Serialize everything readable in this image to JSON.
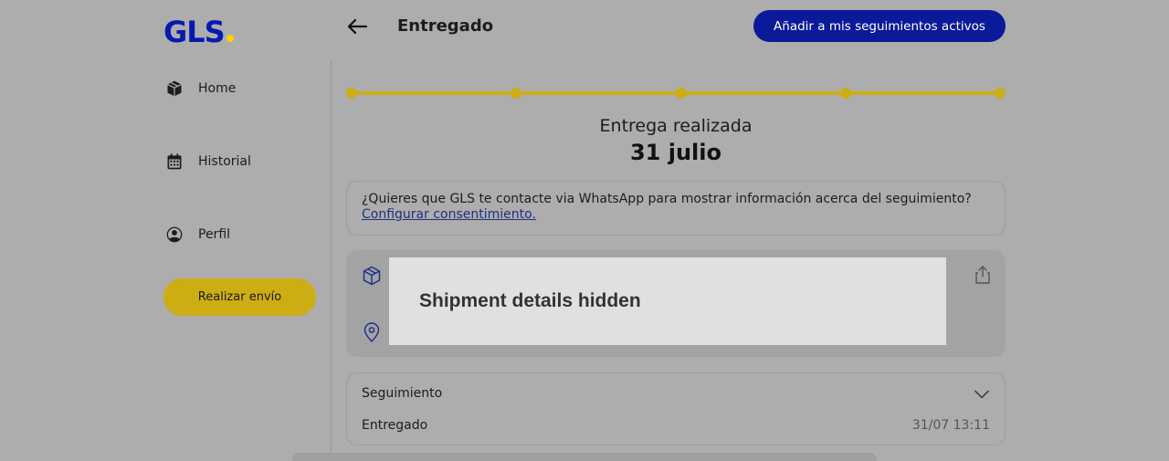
{
  "brand": {
    "logo_text": "GLS",
    "logo_color": "#061ab1",
    "accent_color": "#ffd100"
  },
  "sidebar": {
    "items": [
      {
        "label": "Home",
        "icon": "package-icon"
      },
      {
        "label": "Historial",
        "icon": "calendar-icon"
      },
      {
        "label": "Perfil",
        "icon": "user-icon"
      }
    ],
    "cta_label": "Realizar envío"
  },
  "header": {
    "title": "Entregado",
    "add_button_label": "Añadir a mis seguimientos activos"
  },
  "progress": {
    "steps_total": 5,
    "steps_completed": 5
  },
  "status": {
    "label": "Entrega realizada",
    "date": "31 julio"
  },
  "whatsapp": {
    "question": "¿Quieres que GLS te contacte via WhatsApp para mostrar información acerca del seguimiento?",
    "link_label": "Configurar consentimiento."
  },
  "shipment": {
    "hidden_notice": "Shipment details hidden"
  },
  "tracking": {
    "title": "Seguimiento",
    "event": "Entregado",
    "timestamp": "31/07 13:11"
  }
}
